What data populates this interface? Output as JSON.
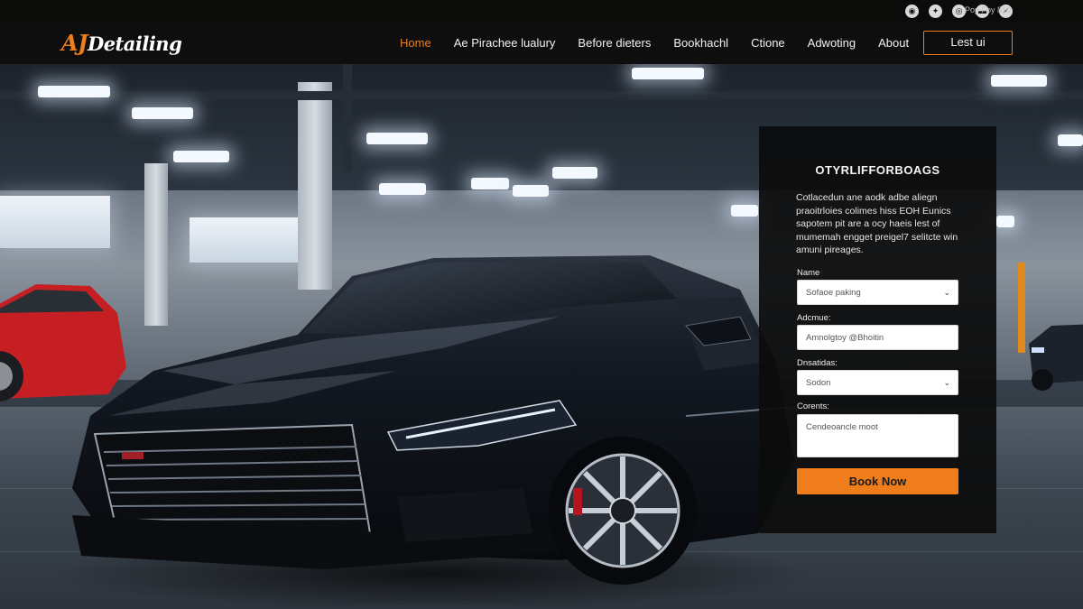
{
  "top_bar": {
    "social_icons": [
      "social-icon-1",
      "social-icon-2",
      "social-icon-3",
      "social-icon-4",
      "social-icon-5"
    ],
    "text": "Pop Fby 810"
  },
  "header": {
    "logo_accent": "AJ",
    "logo_rest": "Detailing",
    "nav": [
      {
        "label": "Home",
        "active": true
      },
      {
        "label": "Ae Pirachee lualury",
        "active": false
      },
      {
        "label": "Before dieters",
        "active": false
      },
      {
        "label": "Bookhachl",
        "active": false
      },
      {
        "label": "Ctione",
        "active": false
      },
      {
        "label": "Adwoting",
        "active": false
      },
      {
        "label": "About",
        "active": false
      }
    ],
    "cta_label": "Lest ui"
  },
  "booking": {
    "title": "OTYRLIFFORBOAGS",
    "description": "Cotlacedun ane aodk adbe aliegn praoitrloies colimes hiss EOH Eunics sapotem pit are a ocy haeis lest of mumemah engget preigel7 selitcte win amuni pireages.",
    "fields": [
      {
        "label": "Name",
        "value": "Sofaoe paking",
        "type": "select"
      },
      {
        "label": "Adcmue:",
        "value": "Amnolgtoy @Bhoitin",
        "type": "text"
      },
      {
        "label": "Dnsatidas:",
        "value": "Sodon",
        "type": "select"
      },
      {
        "label": "Corents:",
        "value": "Cendeoancle moot",
        "type": "textarea"
      }
    ],
    "submit_label": "Book Now"
  },
  "colors": {
    "accent": "#f07d1b",
    "nav_bg": "#0e0e0e",
    "panel_bg": "#0c0c0c"
  }
}
